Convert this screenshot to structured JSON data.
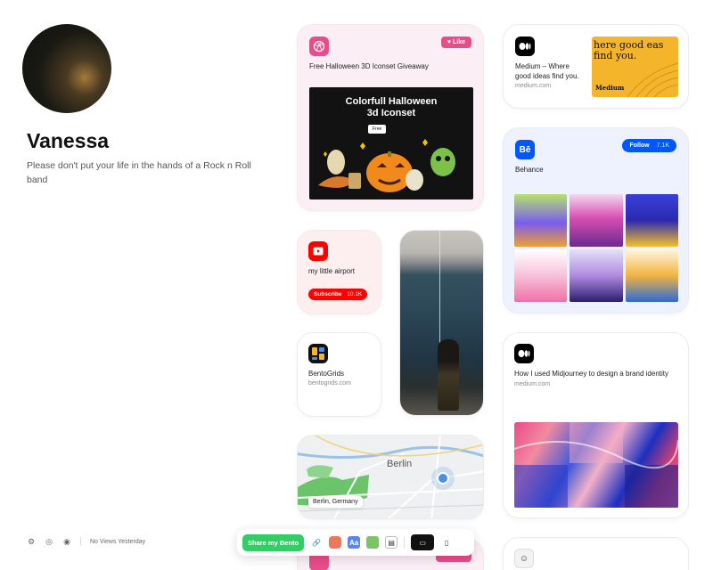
{
  "profile": {
    "name": "Vanessa",
    "bio": "Please don't put your life in the hands of a Rock n Roll band"
  },
  "dribbble": {
    "icon": "dribbble-icon",
    "like_label": "Like",
    "title": "Free Halloween 3D Iconset Giveaway",
    "image_title": "Colorfull Halloween 3d Iconset",
    "image_button": "Free",
    "accent": "#ea4c89"
  },
  "medium_top": {
    "icon": "medium-icon",
    "title": "Medium – Where good ideas find you.",
    "domain": "medium.com",
    "image_text": "here good eas find you.",
    "image_brand": "Medium"
  },
  "behance": {
    "icon_text": "Bē",
    "title": "Behance",
    "follow_label": "Follow",
    "follow_count": "7.1K",
    "accent": "#0057ff"
  },
  "youtube": {
    "icon": "youtube-icon",
    "title": "my little airport",
    "subscribe_label": "Subscribe",
    "subscribe_count": "10.1K",
    "accent": "#ff0000"
  },
  "bentogrids": {
    "title": "BentoGrids",
    "domain": "bentogrids.com"
  },
  "medium_bottom": {
    "icon": "medium-icon",
    "title": "How I used Midjourney to design a brand identity",
    "domain": "medium.com"
  },
  "map": {
    "city": "Berlin",
    "label": "Berlin, Germany"
  },
  "footer": {
    "views": "No Views Yesterday"
  },
  "sharebar": {
    "share_label": "Share my Bento",
    "accent": "#33cc66"
  }
}
